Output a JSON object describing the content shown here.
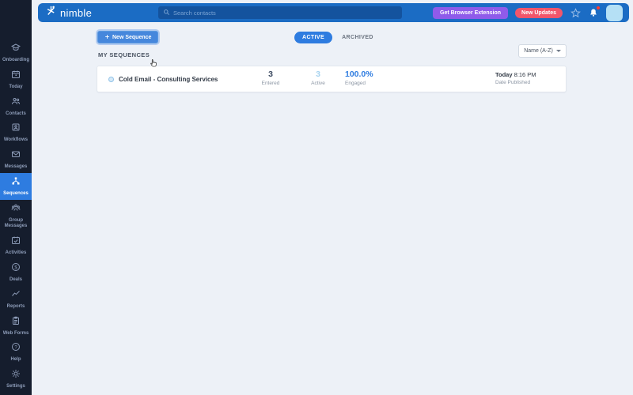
{
  "header": {
    "logo_text": "nimble",
    "search_placeholder": "Search contacts",
    "extension_button": "Get Browser Extension",
    "updates_badge": "New Updates"
  },
  "sidebar": {
    "items": [
      {
        "label": "Onboarding",
        "icon": "graduation-cap-icon",
        "active": false
      },
      {
        "label": "Today",
        "icon": "calendar-icon",
        "active": false
      },
      {
        "label": "Contacts",
        "icon": "people-icon",
        "active": false
      },
      {
        "label": "Workflows",
        "icon": "board-person-icon",
        "active": false
      },
      {
        "label": "Messages",
        "icon": "envelope-icon",
        "active": false
      },
      {
        "label": "Sequences",
        "icon": "org-chart-icon",
        "active": true
      },
      {
        "label": "Group Messages",
        "icon": "group-icon",
        "active": false
      },
      {
        "label": "Activities",
        "icon": "calendar-check-icon",
        "active": false
      },
      {
        "label": "Deals",
        "icon": "dollar-circle-icon",
        "active": false
      },
      {
        "label": "Reports",
        "icon": "line-chart-icon",
        "active": false
      },
      {
        "label": "Web Forms",
        "icon": "clipboard-icon",
        "active": false
      }
    ],
    "footer_items": [
      {
        "label": "Help",
        "icon": "question-circle-icon"
      },
      {
        "label": "Settings",
        "icon": "gear-icon"
      }
    ]
  },
  "toolbar": {
    "new_sequence_label": "New Sequence",
    "tabs": [
      {
        "label": "ACTIVE",
        "active": true
      },
      {
        "label": "ARCHIVED",
        "active": false
      }
    ],
    "sort_label": "Name (A-Z)"
  },
  "sequences": {
    "section_title": "MY SEQUENCES",
    "rows": [
      {
        "title": "Cold Email - Consulting Services",
        "entered_value": "3",
        "entered_label": "Entered",
        "active_value": "3",
        "active_label": "Active",
        "engaged_value": "100.0%",
        "engaged_label": "Engaged",
        "date_day": "Today",
        "date_time": "8:16 PM",
        "date_label": "Date Published"
      }
    ]
  },
  "colors": {
    "header_blue": "#1b6cc4",
    "sidebar_navy": "#151d2d",
    "accent_blue": "#2e7ce0",
    "extension_purple": "#8f5bea",
    "updates_red": "#f2566b",
    "page_background": "#edf1f7",
    "avatar_light_blue": "#b5e0f5",
    "engaged_blue": "#2e7ce0",
    "active_count_blue": "#a6d3ef"
  }
}
